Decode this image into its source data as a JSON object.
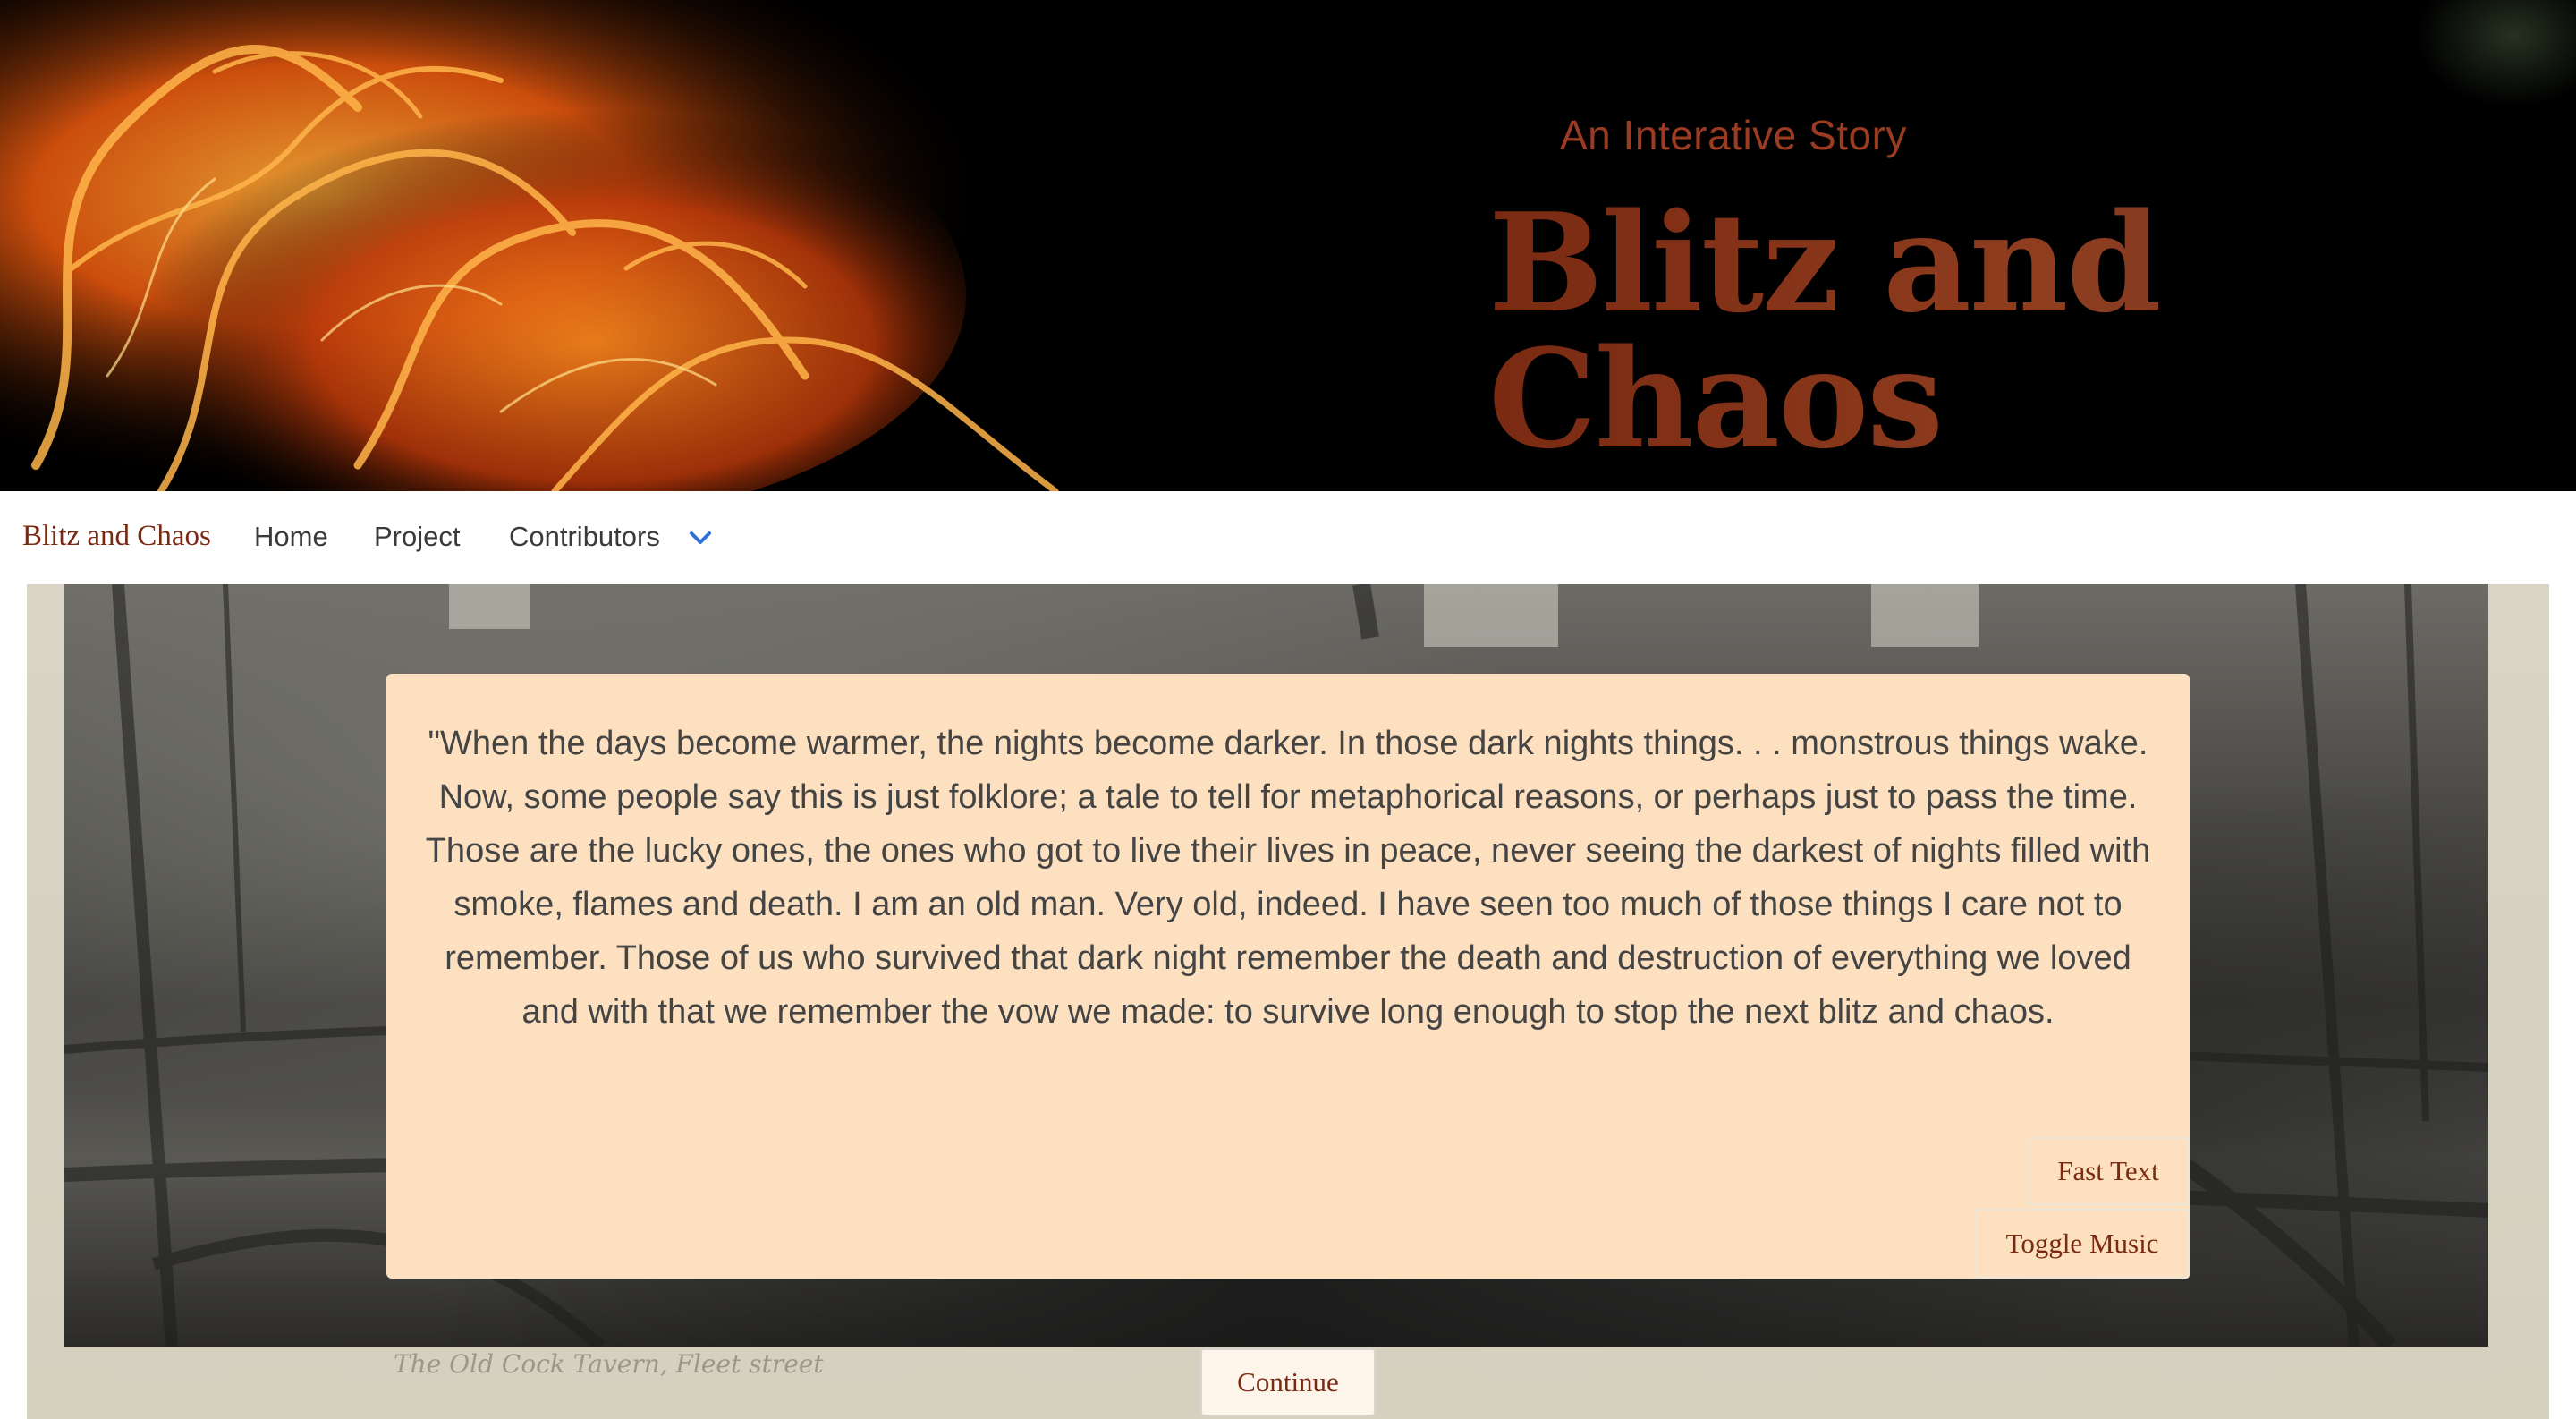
{
  "hero": {
    "subtitle": "An Interative Story",
    "title": "Blitz and Chaos"
  },
  "navbar": {
    "brand": "Blitz and Chaos",
    "links": [
      {
        "label": "Home"
      },
      {
        "label": "Project"
      },
      {
        "label": "Contributors",
        "icon": "chevron-down-icon"
      }
    ]
  },
  "story": {
    "text": "\"When the days become warmer, the nights become darker. In those dark nights things. . . monstrous things wake. Now, some people say this is just folklore; a tale to tell for metaphorical reasons, or perhaps just to pass the time. Those are the lucky ones, the ones who got to live their lives in peace, never seeing the darkest of nights filled with smoke, flames and death. I am an old man. Very old, indeed. I have seen too much of those things I care not to remember. Those of us who survived that dark night remember the death and destruction of everything we loved and with that we remember the vow we made: to survive long enough to stop the next blitz and chaos.",
    "fast_text_label": "Fast Text",
    "toggle_music_label": "Toggle Music"
  },
  "background": {
    "caption": "The Old Cock Tavern, Fleet street"
  },
  "footer": {
    "continue_label": "Continue"
  },
  "colors": {
    "brand": "#7a2a12",
    "card": "#fce0bf",
    "hero_bg": "#000000",
    "chevron": "#2f6fd6"
  }
}
